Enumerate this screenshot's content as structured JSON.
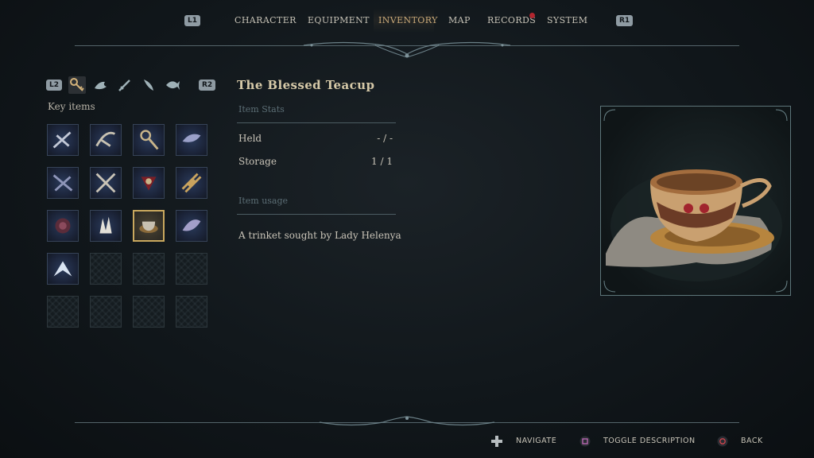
{
  "nav": {
    "left_button": "L1",
    "right_button": "R1",
    "tabs": [
      {
        "label": "CHARACTER",
        "active": false
      },
      {
        "label": "EQUIPMENT",
        "active": false
      },
      {
        "label": "INVENTORY",
        "active": true
      },
      {
        "label": "MAP",
        "active": false
      },
      {
        "label": "RECORDS",
        "active": false,
        "notification": true
      },
      {
        "label": "SYSTEM",
        "active": false
      }
    ]
  },
  "categories": {
    "left_button": "L2",
    "right_button": "R2",
    "icons": [
      "key-icon",
      "bird-icon",
      "sword-icon",
      "feather-icon",
      "fish-icon"
    ],
    "selected_index": 0,
    "label": "Key items"
  },
  "inventory": {
    "columns": 4,
    "rows": 5,
    "filled_slots": 13,
    "selected_slot": 10
  },
  "detail": {
    "title": "The Blessed Teacup",
    "stats_heading": "Item Stats",
    "stats": [
      {
        "label": "Held",
        "value": "- / -"
      },
      {
        "label": "Storage",
        "value": "1 / 1"
      }
    ],
    "usage_heading": "Item usage",
    "usage_text": "A trinket sought by Lady Helenya"
  },
  "footer": {
    "hints": [
      {
        "icon": "dpad-icon",
        "label": "NAVIGATE"
      },
      {
        "icon": "square-button-icon",
        "label": "TOGGLE DESCRIPTION"
      },
      {
        "icon": "circle-button-icon",
        "label": "BACK"
      }
    ]
  },
  "colors": {
    "accent_gold": "#c9a978",
    "notification_red": "#b2262f",
    "background": "#11171b"
  }
}
